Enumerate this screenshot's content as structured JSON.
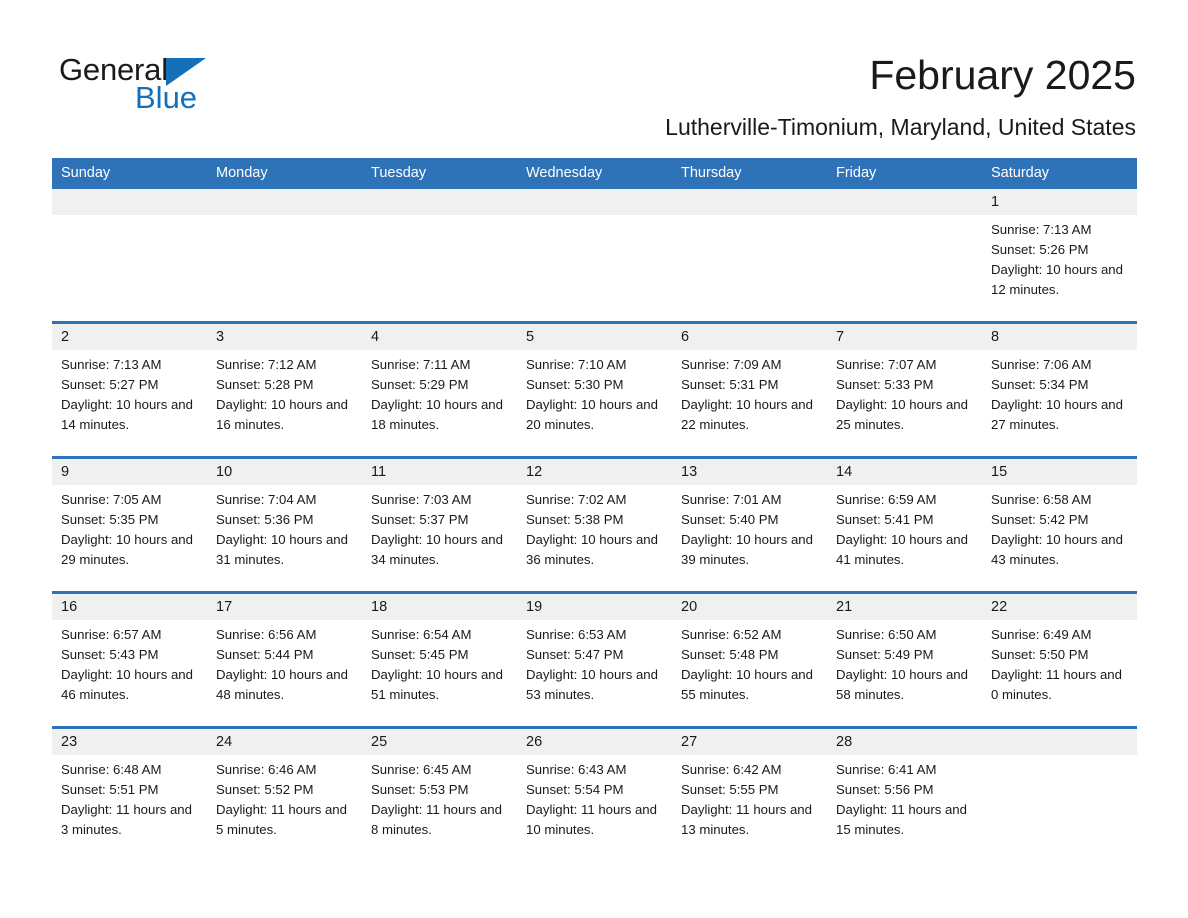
{
  "brand": {
    "name_part1": "General",
    "name_part2": "Blue",
    "accent_color": "#1470B8"
  },
  "header": {
    "month_title": "February 2025",
    "location": "Lutherville-Timonium, Maryland, United States"
  },
  "theme": {
    "header_blue": "#2E72B8",
    "date_band_gray": "#F0F0F0",
    "text_color": "#1a1a1a"
  },
  "calendar": {
    "weekday_headers": [
      "Sunday",
      "Monday",
      "Tuesday",
      "Wednesday",
      "Thursday",
      "Friday",
      "Saturday"
    ],
    "labels": {
      "sunrise_prefix": "Sunrise: ",
      "sunset_prefix": "Sunset: ",
      "daylight_prefix": "Daylight: "
    },
    "weeks": [
      [
        {
          "day": "",
          "empty": true
        },
        {
          "day": "",
          "empty": true
        },
        {
          "day": "",
          "empty": true
        },
        {
          "day": "",
          "empty": true
        },
        {
          "day": "",
          "empty": true
        },
        {
          "day": "",
          "empty": true
        },
        {
          "day": "1",
          "sunrise": "Sunrise: 7:13 AM",
          "sunset": "Sunset: 5:26 PM",
          "daylight": "Daylight: 10 hours and 12 minutes."
        }
      ],
      [
        {
          "day": "2",
          "sunrise": "Sunrise: 7:13 AM",
          "sunset": "Sunset: 5:27 PM",
          "daylight": "Daylight: 10 hours and 14 minutes."
        },
        {
          "day": "3",
          "sunrise": "Sunrise: 7:12 AM",
          "sunset": "Sunset: 5:28 PM",
          "daylight": "Daylight: 10 hours and 16 minutes."
        },
        {
          "day": "4",
          "sunrise": "Sunrise: 7:11 AM",
          "sunset": "Sunset: 5:29 PM",
          "daylight": "Daylight: 10 hours and 18 minutes."
        },
        {
          "day": "5",
          "sunrise": "Sunrise: 7:10 AM",
          "sunset": "Sunset: 5:30 PM",
          "daylight": "Daylight: 10 hours and 20 minutes."
        },
        {
          "day": "6",
          "sunrise": "Sunrise: 7:09 AM",
          "sunset": "Sunset: 5:31 PM",
          "daylight": "Daylight: 10 hours and 22 minutes."
        },
        {
          "day": "7",
          "sunrise": "Sunrise: 7:07 AM",
          "sunset": "Sunset: 5:33 PM",
          "daylight": "Daylight: 10 hours and 25 minutes."
        },
        {
          "day": "8",
          "sunrise": "Sunrise: 7:06 AM",
          "sunset": "Sunset: 5:34 PM",
          "daylight": "Daylight: 10 hours and 27 minutes."
        }
      ],
      [
        {
          "day": "9",
          "sunrise": "Sunrise: 7:05 AM",
          "sunset": "Sunset: 5:35 PM",
          "daylight": "Daylight: 10 hours and 29 minutes."
        },
        {
          "day": "10",
          "sunrise": "Sunrise: 7:04 AM",
          "sunset": "Sunset: 5:36 PM",
          "daylight": "Daylight: 10 hours and 31 minutes."
        },
        {
          "day": "11",
          "sunrise": "Sunrise: 7:03 AM",
          "sunset": "Sunset: 5:37 PM",
          "daylight": "Daylight: 10 hours and 34 minutes."
        },
        {
          "day": "12",
          "sunrise": "Sunrise: 7:02 AM",
          "sunset": "Sunset: 5:38 PM",
          "daylight": "Daylight: 10 hours and 36 minutes."
        },
        {
          "day": "13",
          "sunrise": "Sunrise: 7:01 AM",
          "sunset": "Sunset: 5:40 PM",
          "daylight": "Daylight: 10 hours and 39 minutes."
        },
        {
          "day": "14",
          "sunrise": "Sunrise: 6:59 AM",
          "sunset": "Sunset: 5:41 PM",
          "daylight": "Daylight: 10 hours and 41 minutes."
        },
        {
          "day": "15",
          "sunrise": "Sunrise: 6:58 AM",
          "sunset": "Sunset: 5:42 PM",
          "daylight": "Daylight: 10 hours and 43 minutes."
        }
      ],
      [
        {
          "day": "16",
          "sunrise": "Sunrise: 6:57 AM",
          "sunset": "Sunset: 5:43 PM",
          "daylight": "Daylight: 10 hours and 46 minutes."
        },
        {
          "day": "17",
          "sunrise": "Sunrise: 6:56 AM",
          "sunset": "Sunset: 5:44 PM",
          "daylight": "Daylight: 10 hours and 48 minutes."
        },
        {
          "day": "18",
          "sunrise": "Sunrise: 6:54 AM",
          "sunset": "Sunset: 5:45 PM",
          "daylight": "Daylight: 10 hours and 51 minutes."
        },
        {
          "day": "19",
          "sunrise": "Sunrise: 6:53 AM",
          "sunset": "Sunset: 5:47 PM",
          "daylight": "Daylight: 10 hours and 53 minutes."
        },
        {
          "day": "20",
          "sunrise": "Sunrise: 6:52 AM",
          "sunset": "Sunset: 5:48 PM",
          "daylight": "Daylight: 10 hours and 55 minutes."
        },
        {
          "day": "21",
          "sunrise": "Sunrise: 6:50 AM",
          "sunset": "Sunset: 5:49 PM",
          "daylight": "Daylight: 10 hours and 58 minutes."
        },
        {
          "day": "22",
          "sunrise": "Sunrise: 6:49 AM",
          "sunset": "Sunset: 5:50 PM",
          "daylight": "Daylight: 11 hours and 0 minutes."
        }
      ],
      [
        {
          "day": "23",
          "sunrise": "Sunrise: 6:48 AM",
          "sunset": "Sunset: 5:51 PM",
          "daylight": "Daylight: 11 hours and 3 minutes."
        },
        {
          "day": "24",
          "sunrise": "Sunrise: 6:46 AM",
          "sunset": "Sunset: 5:52 PM",
          "daylight": "Daylight: 11 hours and 5 minutes."
        },
        {
          "day": "25",
          "sunrise": "Sunrise: 6:45 AM",
          "sunset": "Sunset: 5:53 PM",
          "daylight": "Daylight: 11 hours and 8 minutes."
        },
        {
          "day": "26",
          "sunrise": "Sunrise: 6:43 AM",
          "sunset": "Sunset: 5:54 PM",
          "daylight": "Daylight: 11 hours and 10 minutes."
        },
        {
          "day": "27",
          "sunrise": "Sunrise: 6:42 AM",
          "sunset": "Sunset: 5:55 PM",
          "daylight": "Daylight: 11 hours and 13 minutes."
        },
        {
          "day": "28",
          "sunrise": "Sunrise: 6:41 AM",
          "sunset": "Sunset: 5:56 PM",
          "daylight": "Daylight: 11 hours and 15 minutes."
        },
        {
          "day": "",
          "empty": true
        }
      ]
    ]
  }
}
